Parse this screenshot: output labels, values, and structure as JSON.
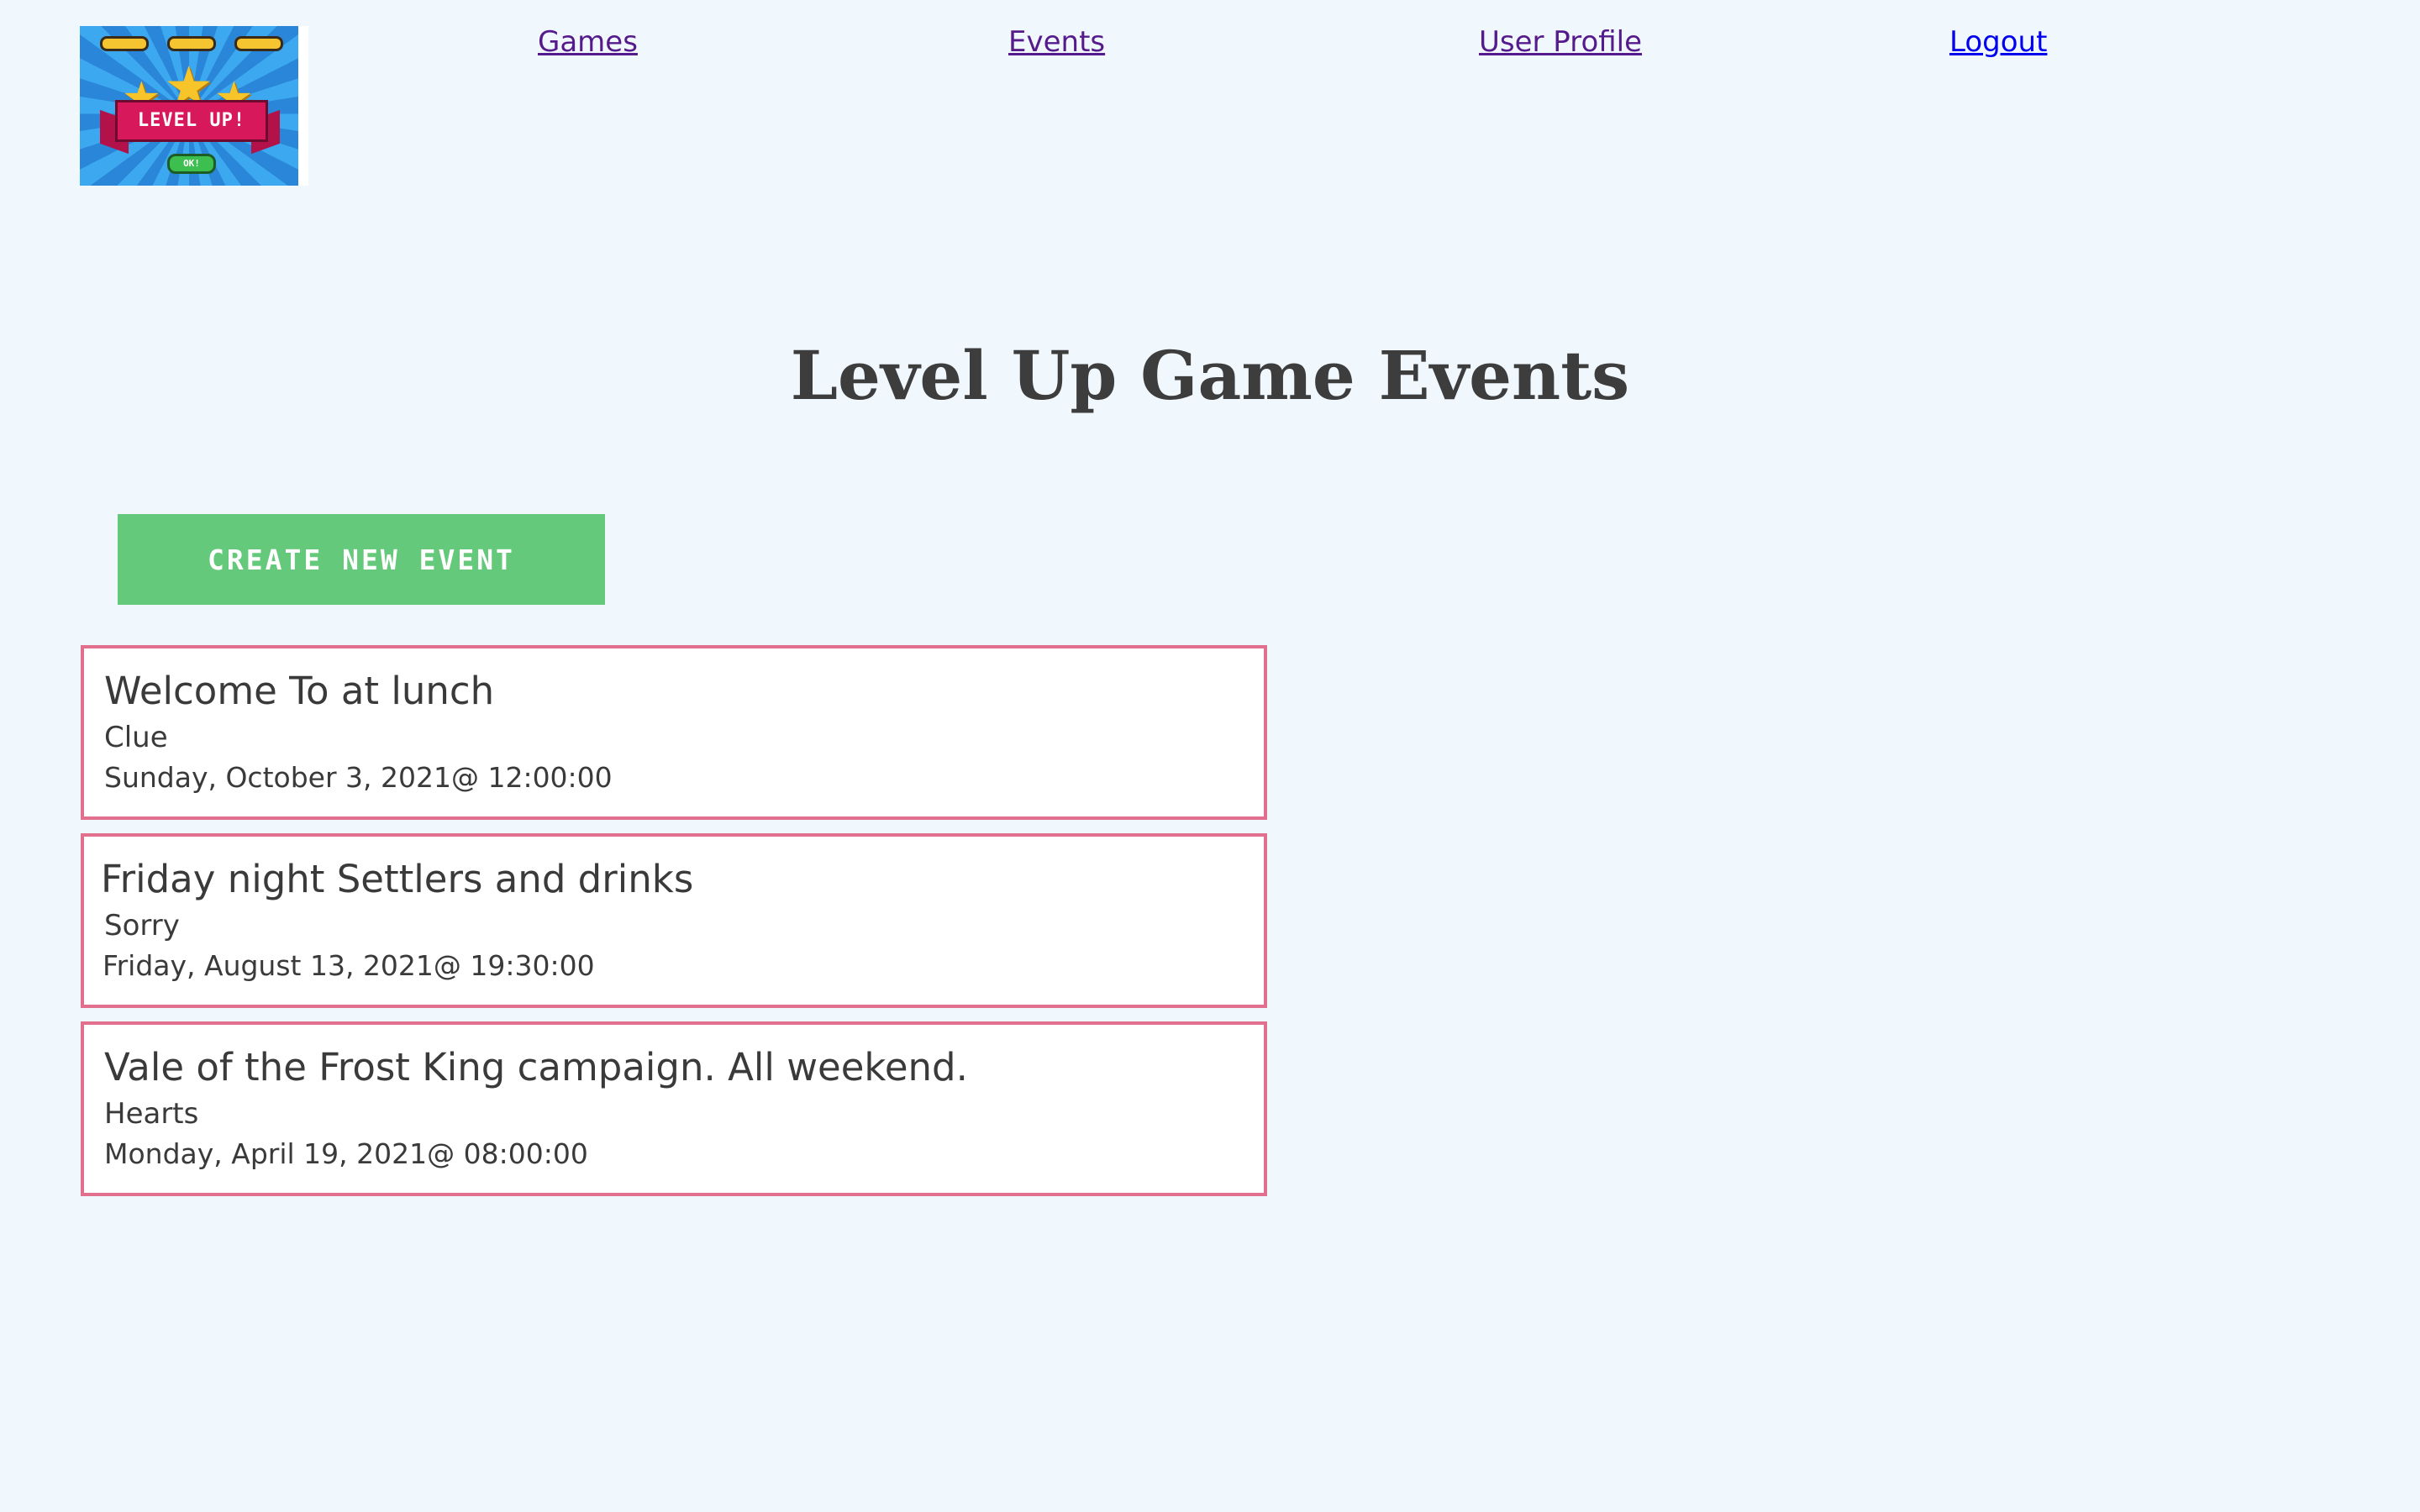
{
  "logo": {
    "ribbon_text": "LEVEL UP!",
    "pill_text": "OK!"
  },
  "nav": {
    "games": "Games",
    "events": "Events",
    "profile": "User Profile",
    "logout": "Logout"
  },
  "page_title": "Level Up Game Events",
  "create_button": "CREATE NEW EVENT",
  "events": [
    {
      "title": "Welcome To at lunch",
      "game": "Clue",
      "datetime": "Sunday, October 3, 2021@ 12:00:00"
    },
    {
      "title": "Friday night Settlers and drinks",
      "game": "Sorry",
      "datetime": "Friday, August 13, 2021@ 19:30:00"
    },
    {
      "title": "Vale of the Frost King campaign. All weekend.",
      "game": "Hearts",
      "datetime": "Monday, April 19, 2021@ 08:00:00"
    }
  ],
  "colors": {
    "background": "#f0f8fe",
    "button": "#64c97a",
    "card_border": "#e0708e",
    "link_visited": "#551a8b",
    "link_unvisited": "#0000ee"
  }
}
